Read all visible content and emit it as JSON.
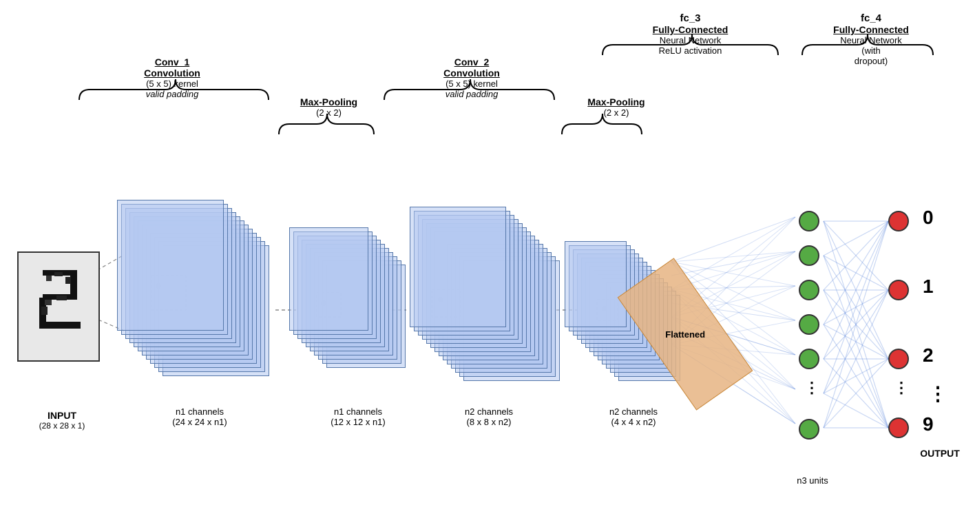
{
  "labels": {
    "conv1": {
      "title": "Conv_1",
      "subtitle": "Convolution",
      "line1": "(5 x 5) kernel",
      "line2": "valid padding"
    },
    "maxpool1": {
      "title": "Max-Pooling",
      "line1": "(2 x 2)"
    },
    "conv2": {
      "title": "Conv_2",
      "subtitle": "Convolution",
      "line1": "(5 x 5) kernel",
      "line2": "valid padding"
    },
    "maxpool2": {
      "title": "Max-Pooling",
      "line1": "(2 x 2)"
    },
    "fc3": {
      "title": "fc_3",
      "subtitle": "Fully-Connected",
      "line1": "Neural Network",
      "line2": "ReLU activation"
    },
    "fc4": {
      "title": "fc_4",
      "subtitle": "Fully-Connected",
      "line1": "Neural Network",
      "line2": "(with",
      "line3": "dropout)"
    }
  },
  "captions": {
    "input": {
      "main": "INPUT",
      "dim": "(28 x 28 x 1)"
    },
    "after_conv1": {
      "main": "n1 channels",
      "dim": "(24 x 24 x n1)"
    },
    "after_pool1": {
      "main": "n1 channels",
      "dim": "(12 x 12 x n1)"
    },
    "after_conv2": {
      "main": "n2 channels",
      "dim": "(8 x 8 x n2)"
    },
    "after_pool2": {
      "main": "n2 channels",
      "dim": "(4 x 4 x n2)"
    },
    "n3": {
      "main": "n3 units"
    },
    "output": {
      "main": "OUTPUT"
    }
  },
  "flattened_label": "Flattened",
  "output_digits": [
    "0",
    "1",
    "2",
    "⋮",
    "9"
  ],
  "colors": {
    "fmap_border": "#5577aa",
    "fmap_fill": "rgba(180,200,240,0.55)",
    "green_node": "#55aa44",
    "red_node": "#dd3333",
    "connection_color": "rgba(100,140,220,0.35)"
  }
}
